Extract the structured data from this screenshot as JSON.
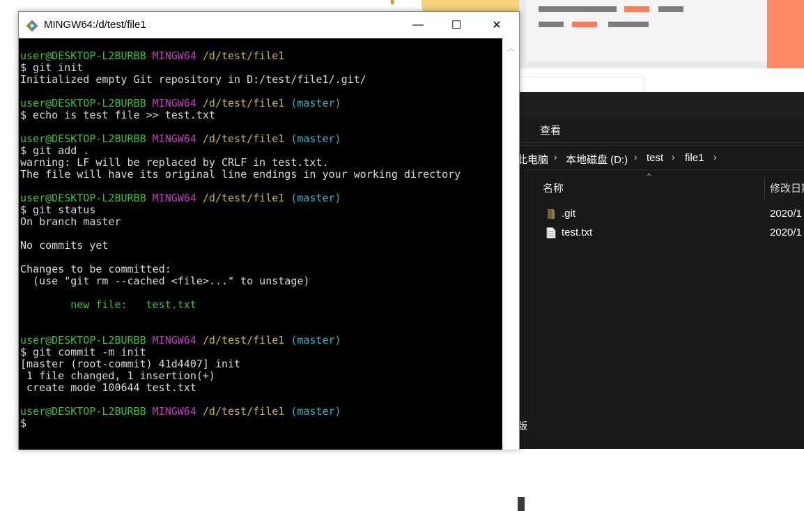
{
  "background": {
    "colors": {
      "accent_orange": "#ff8a65",
      "light_gray": "#eaeaea",
      "yellow": "#f5d27a"
    }
  },
  "terminal": {
    "title": "MINGW64:/d/test/file1",
    "icon": "git-logo-icon",
    "controls": {
      "minimize": "—",
      "maximize": "☐",
      "close": "✕"
    },
    "colors": {
      "prompt_user": "#33c23a",
      "prompt_env": "#c23bbf",
      "prompt_path": "#c6b72f",
      "prompt_branch": "#22b5c4",
      "staged_file": "#33c23a",
      "background": "#000000"
    },
    "lines": [
      {
        "user": "user@DESKTOP-L2BURBB",
        "env": "MINGW64",
        "path": "/d/test/file1",
        "branch": ""
      },
      {
        "text": "$ git init"
      },
      {
        "text": "Initialized empty Git repository in D:/test/file1/.git/"
      },
      {
        "text": ""
      },
      {
        "user": "user@DESKTOP-L2BURBB",
        "env": "MINGW64",
        "path": "/d/test/file1",
        "branch": "(master)"
      },
      {
        "text": "$ echo is test file >> test.txt"
      },
      {
        "text": ""
      },
      {
        "user": "user@DESKTOP-L2BURBB",
        "env": "MINGW64",
        "path": "/d/test/file1",
        "branch": "(master)"
      },
      {
        "text": "$ git add ."
      },
      {
        "text": "warning: LF will be replaced by CRLF in test.txt."
      },
      {
        "text": "The file will have its original line endings in your working directory"
      },
      {
        "text": ""
      },
      {
        "user": "user@DESKTOP-L2BURBB",
        "env": "MINGW64",
        "path": "/d/test/file1",
        "branch": "(master)"
      },
      {
        "text": "$ git status"
      },
      {
        "text": "On branch master"
      },
      {
        "text": ""
      },
      {
        "text": "No commits yet"
      },
      {
        "text": ""
      },
      {
        "text": "Changes to be committed:"
      },
      {
        "text": "  (use \"git rm --cached <file>...\" to unstage)"
      },
      {
        "text": ""
      },
      {
        "text": "        new file:   test.txt",
        "color": "green"
      },
      {
        "text": ""
      },
      {
        "text": ""
      },
      {
        "user": "user@DESKTOP-L2BURBB",
        "env": "MINGW64",
        "path": "/d/test/file1",
        "branch": "(master)"
      },
      {
        "text": "$ git commit -m init"
      },
      {
        "text": "[master (root-commit) 41d4407] init"
      },
      {
        "text": " 1 file changed, 1 insertion(+)"
      },
      {
        "text": " create mode 100644 test.txt"
      },
      {
        "text": ""
      },
      {
        "user": "user@DESKTOP-L2BURBB",
        "env": "MINGW64",
        "path": "/d/test/file1",
        "branch": "(master)"
      },
      {
        "text": "$"
      }
    ]
  },
  "explorer": {
    "ribbon": {
      "view_tab": "查看"
    },
    "breadcrumb": {
      "items": [
        "此电脑",
        "本地磁盘 (D:)",
        "test",
        "file1"
      ],
      "separator": "›"
    },
    "navpane_label": "版",
    "columns": {
      "name": "名称",
      "modified": "修改日期"
    },
    "files": [
      {
        "name": ".git",
        "date": "2020/1",
        "icon": "folder-icon"
      },
      {
        "name": "test.txt",
        "date": "2020/1",
        "icon": "text-file-icon"
      }
    ]
  }
}
